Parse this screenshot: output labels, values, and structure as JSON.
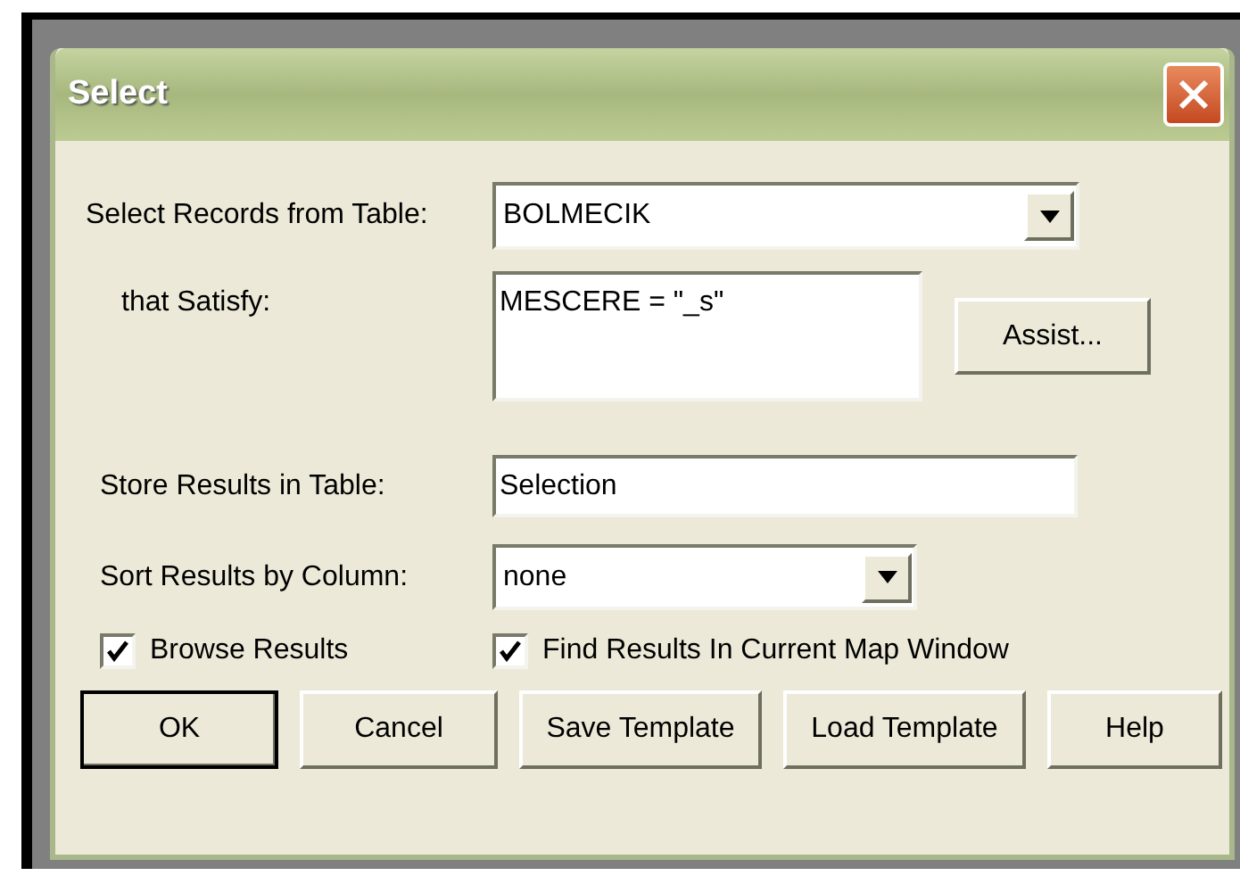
{
  "window": {
    "title": "Select"
  },
  "table_row": {
    "label": "Select Records from Table:",
    "value": "BOLMECIK"
  },
  "condition": {
    "label": "that Satisfy:",
    "value": "MESCERE = \"_s\"",
    "assist_button": "Assist..."
  },
  "store_row": {
    "label": "Store Results in Table:",
    "value": "Selection"
  },
  "sort_row": {
    "label": "Sort Results by Column:",
    "value": "none"
  },
  "checkboxes": [
    {
      "label": "Browse Results",
      "checked": true
    },
    {
      "label": "Find Results In Current Map Window",
      "checked": true
    }
  ],
  "buttons": [
    {
      "label": "OK",
      "default": true
    },
    {
      "label": "Cancel",
      "default": false
    },
    {
      "label": "Save Template",
      "default": false
    },
    {
      "label": "Load Template",
      "default": false
    },
    {
      "label": "Help",
      "default": false
    }
  ]
}
